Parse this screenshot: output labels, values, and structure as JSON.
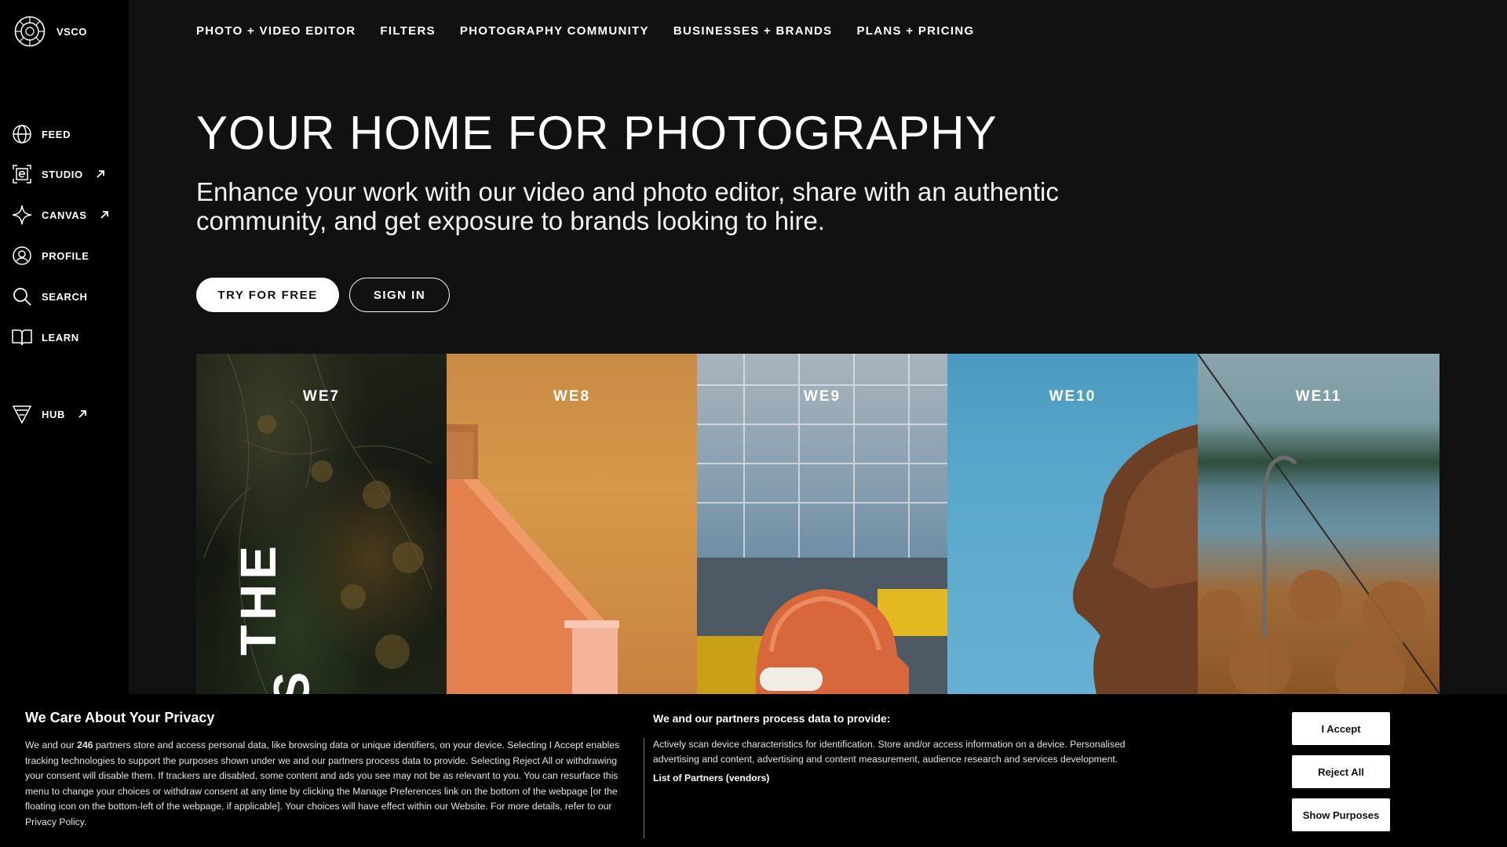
{
  "brand": {
    "name": "VSCO"
  },
  "sidebar": {
    "items": [
      {
        "label": "FEED",
        "icon": "globe-icon",
        "external": false
      },
      {
        "label": "STUDIO",
        "icon": "studio-icon",
        "external": true
      },
      {
        "label": "CANVAS",
        "icon": "sparkle-icon",
        "external": true
      },
      {
        "label": "PROFILE",
        "icon": "profile-icon",
        "external": false
      },
      {
        "label": "SEARCH",
        "icon": "search-icon",
        "external": false
      },
      {
        "label": "LEARN",
        "icon": "book-icon",
        "external": false
      },
      {
        "label": "HUB",
        "icon": "hub-icon",
        "external": true
      }
    ]
  },
  "topnav": {
    "items": [
      "PHOTO + VIDEO EDITOR",
      "FILTERS",
      "PHOTOGRAPHY COMMUNITY",
      "BUSINESSES + BRANDS",
      "PLANS + PRICING"
    ]
  },
  "hero": {
    "title": "YOUR HOME FOR PHOTOGRAPHY",
    "subtitle": "Enhance your work with our video and photo editor, share with an authentic community, and get exposure to brands looking to hire.",
    "primary_cta": "TRY FOR FREE",
    "secondary_cta": "SIGN IN"
  },
  "gallery": {
    "panels": [
      "WE7",
      "WE8",
      "WE9",
      "WE10",
      "WE11"
    ],
    "overlay_word": "THE",
    "overlay_letter": "S"
  },
  "privacy": {
    "title": "We Care About Your Privacy",
    "body_prefix": "We and our ",
    "partner_count": "246",
    "body_suffix": " partners store and access personal data, like browsing data or unique identifiers, on your device. Selecting I Accept enables tracking technologies to support the purposes shown under we and our partners process data to provide. Selecting Reject All or withdrawing your consent will disable them. If trackers are disabled, some content and ads you see may not be as relevant to you. You can resurface this menu to change your choices or withdraw consent at any time by clicking the Manage Preferences link on the bottom of the webpage [or the floating icon on the bottom-left of the webpage, if applicable]. Your choices will have effect within our Website. For more details, refer to our Privacy Policy.",
    "purposes_title": "We and our partners process data to provide:",
    "purposes_text": "Actively scan device characteristics for identification. Store and/or access information on a device. Personalised advertising and content, advertising and content measurement, audience research and services development.",
    "partners_link": "List of Partners (vendors)",
    "accept_label": "I Accept",
    "reject_label": "Reject All",
    "purposes_button": "Show Purposes"
  }
}
